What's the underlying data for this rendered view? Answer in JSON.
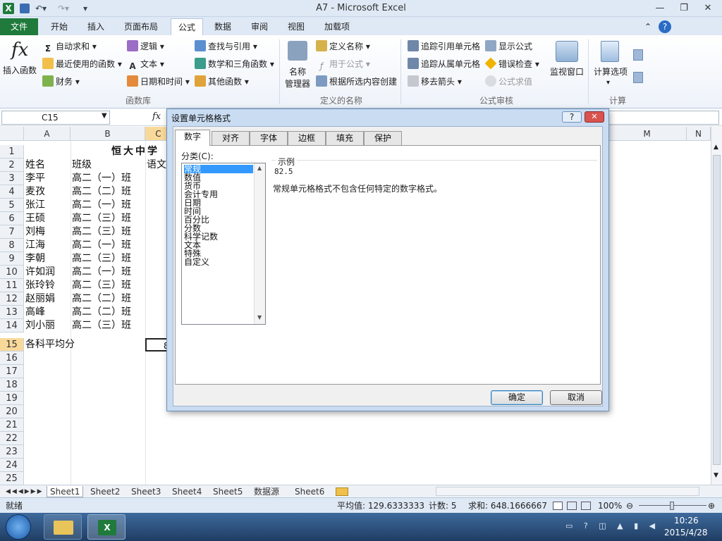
{
  "app": {
    "title": "A7 - Microsoft Excel"
  },
  "quick_access": {
    "undo": "↶▾",
    "redo": "↷▾",
    "customize": "▾"
  },
  "window_controls": {
    "minimize": "—",
    "restore": "❐",
    "close": "✕"
  },
  "ribbon_tabs": [
    "文件",
    "开始",
    "插入",
    "页面布局",
    "公式",
    "数据",
    "审阅",
    "视图",
    "加载项"
  ],
  "active_tab": "公式",
  "ribbon": {
    "insert_function": {
      "glyph": "fx",
      "label": "插入函数"
    },
    "autosum": "自动求和",
    "recent": "最近使用的函数",
    "financial": "财务",
    "logical": "逻辑",
    "text": "文本",
    "datetime": "日期和时间",
    "lookup": "查找与引用",
    "math": "数学和三角函数",
    "other": "其他函数",
    "group_library": "函数库",
    "name_manager_1": "名称",
    "name_manager_2": "管理器",
    "define_name": "定义名称",
    "use_in_formula": "用于公式",
    "create_from_sel": "根据所选内容创建",
    "group_names": "定义的名称",
    "trace_precedents": "追踪引用单元格",
    "trace_dependents": "追踪从属单元格",
    "remove_arrows": "移去箭头",
    "show_formulas": "显示公式",
    "error_checking": "错误检查",
    "evaluate": "公式求值",
    "watch_window": "监视窗口",
    "group_audit": "公式审核",
    "calc_options": "计算选项",
    "group_calc": "计算"
  },
  "formula_bar": {
    "name_box": "C15",
    "fx": "fx",
    "value": ""
  },
  "columns": [
    "A",
    "B",
    "C",
    "M",
    "N"
  ],
  "rows": [
    "1",
    "2",
    "3",
    "4",
    "5",
    "6",
    "7",
    "8",
    "9",
    "10",
    "11",
    "12",
    "13",
    "14",
    "15",
    "16",
    "17",
    "18",
    "19",
    "20",
    "21",
    "22",
    "23",
    "24",
    "25"
  ],
  "sheet": {
    "title_partial": "恒大中学",
    "header": {
      "name": "姓名",
      "class": "班级",
      "chinese": "语文"
    },
    "data": [
      {
        "name": "李平",
        "class": "高二（一）班"
      },
      {
        "name": "麦孜",
        "class": "高二（二）班"
      },
      {
        "name": "张江",
        "class": "高二（一）班"
      },
      {
        "name": "王硕",
        "class": "高二（三）班"
      },
      {
        "name": "刘梅",
        "class": "高二（三）班"
      },
      {
        "name": "江海",
        "class": "高二（一）班"
      },
      {
        "name": "李朝",
        "class": "高二（三）班"
      },
      {
        "name": "许如润",
        "class": "高二（一）班"
      },
      {
        "name": "张玲铃",
        "class": "高二（三）班"
      },
      {
        "name": "赵丽娟",
        "class": "高二（二）班"
      },
      {
        "name": "高峰",
        "class": "高二（二）班"
      },
      {
        "name": "刘小丽",
        "class": "高二（三）班"
      }
    ],
    "avg_label": "各科平均分",
    "c15_partial": "8"
  },
  "sheet_tabs": [
    "Sheet1",
    "Sheet2",
    "Sheet3",
    "Sheet4",
    "Sheet5",
    "数据源",
    "Sheet6"
  ],
  "active_sheet": "Sheet1",
  "status": {
    "ready": "就绪",
    "average": "平均值: 129.6333333",
    "count": "计数: 5",
    "sum": "求和: 648.1666667",
    "zoom": "100%"
  },
  "taskbar": {
    "time": "10:26",
    "date": "2015/4/28"
  },
  "dialog": {
    "title": "设置单元格格式",
    "help": "?",
    "close": "✕",
    "tabs": [
      "数字",
      "对齐",
      "字体",
      "边框",
      "填充",
      "保护"
    ],
    "active_tab": "数字",
    "category_label": "分类(C):",
    "categories": [
      "常规",
      "数值",
      "货币",
      "会计专用",
      "日期",
      "时间",
      "百分比",
      "分数",
      "科学记数",
      "文本",
      "特殊",
      "自定义"
    ],
    "selected_category": "常规",
    "sample_label": "示例",
    "sample_value": "82.5",
    "description": "常规单元格格式不包含任何特定的数字格式。",
    "ok": "确定",
    "cancel": "取消"
  },
  "colors": {
    "file_tab": "#1f7a3b",
    "selection": "#3399ff",
    "dialog_frame": "#c9dcf2"
  }
}
